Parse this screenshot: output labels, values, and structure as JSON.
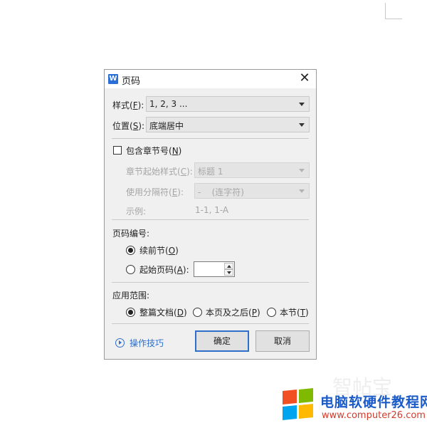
{
  "dialog": {
    "title": "页码",
    "app_icon_letter": "W",
    "close_glyph": "✕"
  },
  "style_row": {
    "label": "样式(",
    "key": "F",
    "label_end": "):",
    "value": "1, 2, 3 ..."
  },
  "position_row": {
    "label": "位置(",
    "key": "S",
    "label_end": "):",
    "value": "底端居中"
  },
  "include_chapter": {
    "label": "包含章节号(",
    "key": "N",
    "label_end": ")",
    "checked": false
  },
  "chapter_style": {
    "label": "章节起始样式(",
    "key": "C",
    "label_end": "):",
    "value": "标题 1"
  },
  "separator": {
    "label": "使用分隔符(",
    "key": "E",
    "label_end": "):",
    "value": "-    (连字符)"
  },
  "example": {
    "label": "示例:",
    "value": "1-1, 1-A"
  },
  "numbering": {
    "heading": "页码编号:",
    "continue_label": "续前节(",
    "continue_key": "O",
    "continue_end": ")",
    "start_label": "起始页码(",
    "start_key": "A",
    "start_end": "):",
    "start_value": "",
    "selected": "continue"
  },
  "apply": {
    "heading": "应用范围:",
    "whole_label": "整篇文档(",
    "whole_key": "D",
    "whole_end": ")",
    "after_label": "本页及之后(",
    "after_key": "P",
    "after_end": ")",
    "section_label": "本节(",
    "section_key": "T",
    "section_end": ")",
    "selected": "whole"
  },
  "footer": {
    "tips_label": "操作技巧",
    "ok_label": "确定",
    "cancel_label": "取消"
  },
  "watermark": {
    "title": "电脑软硬件教程网",
    "url": "www.computer26.com",
    "faint_text": "智帖宝"
  },
  "colors": {
    "link": "#2f6fc9",
    "dialog_bg": "#f0f0f0",
    "watermark_blue": "#1a5bc7",
    "watermark_red": "#d43a2a"
  }
}
